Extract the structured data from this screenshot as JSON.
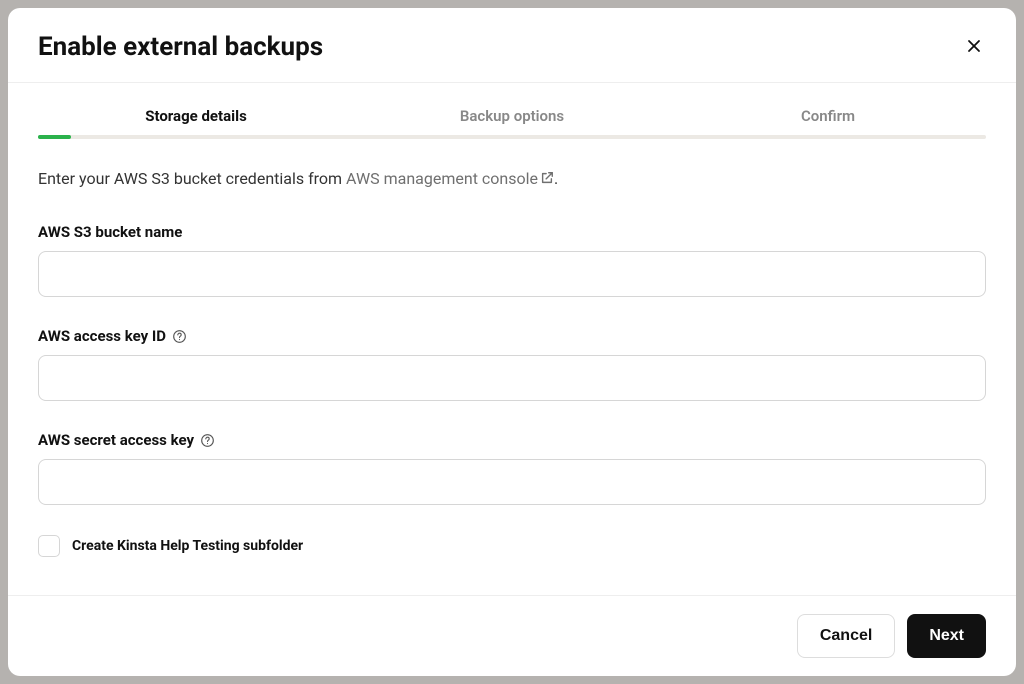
{
  "modal": {
    "title": "Enable external backups"
  },
  "stepper": {
    "steps": [
      {
        "label": "Storage details",
        "active": true
      },
      {
        "label": "Backup options",
        "active": false
      },
      {
        "label": "Confirm",
        "active": false
      }
    ]
  },
  "instruction": {
    "prefix": "Enter your AWS S3 bucket credentials from ",
    "link_text": "AWS management console",
    "suffix": "."
  },
  "fields": {
    "bucket_name": {
      "label": "AWS S3 bucket name",
      "value": ""
    },
    "access_key_id": {
      "label": "AWS access key ID",
      "value": ""
    },
    "secret_access_key": {
      "label": "AWS secret access key",
      "value": ""
    }
  },
  "checkbox": {
    "label": "Create Kinsta Help Testing subfolder",
    "checked": false
  },
  "footer": {
    "cancel_label": "Cancel",
    "next_label": "Next"
  }
}
